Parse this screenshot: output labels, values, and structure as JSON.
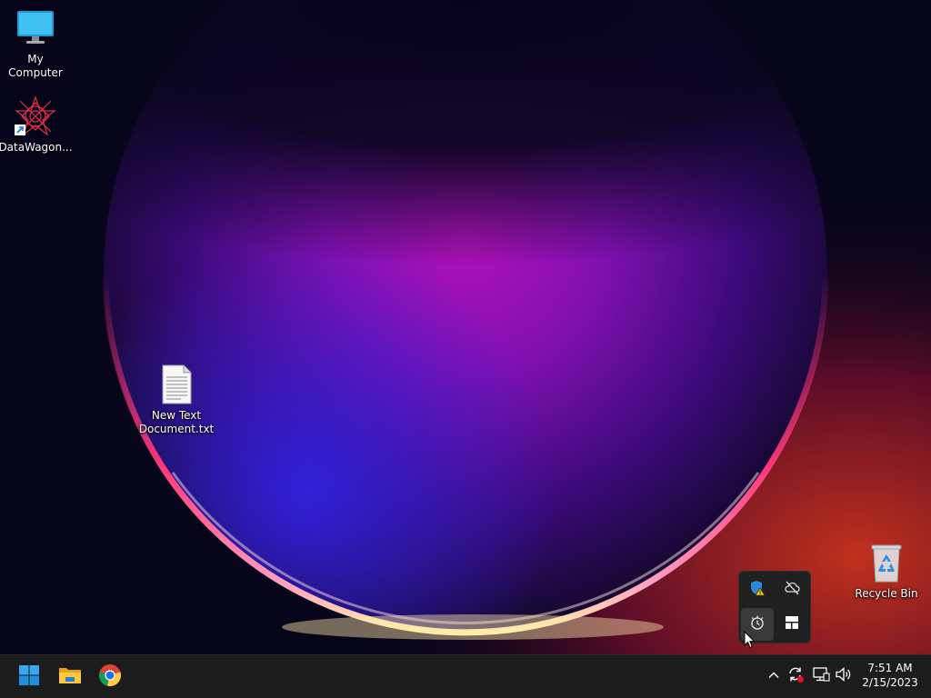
{
  "desktop": {
    "icons": [
      {
        "label": "My Computer",
        "icon": "monitor-icon"
      },
      {
        "label": "DataWagon...",
        "icon": "datawagon-logo-icon"
      },
      {
        "label": "New Text\nDocument.txt",
        "icon": "text-document-icon"
      },
      {
        "label": "Recycle Bin",
        "icon": "recycle-bin-icon"
      }
    ]
  },
  "tray_flyout": {
    "icons": [
      "security-warning-icon",
      "cloud-offline-icon",
      "alarm-clock-icon",
      "grid-app-icon"
    ]
  },
  "taskbar": {
    "pinned": [
      "windows-start-icon",
      "file-explorer-icon",
      "chrome-icon"
    ],
    "tray": [
      "chevron-up-icon",
      "sync-alert-icon",
      "network-icon",
      "volume-icon"
    ],
    "clock": {
      "time": "7:51 AM",
      "date": "2/15/2023"
    }
  },
  "colors": {
    "accent": "#0078d4",
    "taskbar": "#1c1c1c",
    "wallpaper_center": "#a010b8",
    "wallpaper_rim": "#ff4fa0"
  }
}
